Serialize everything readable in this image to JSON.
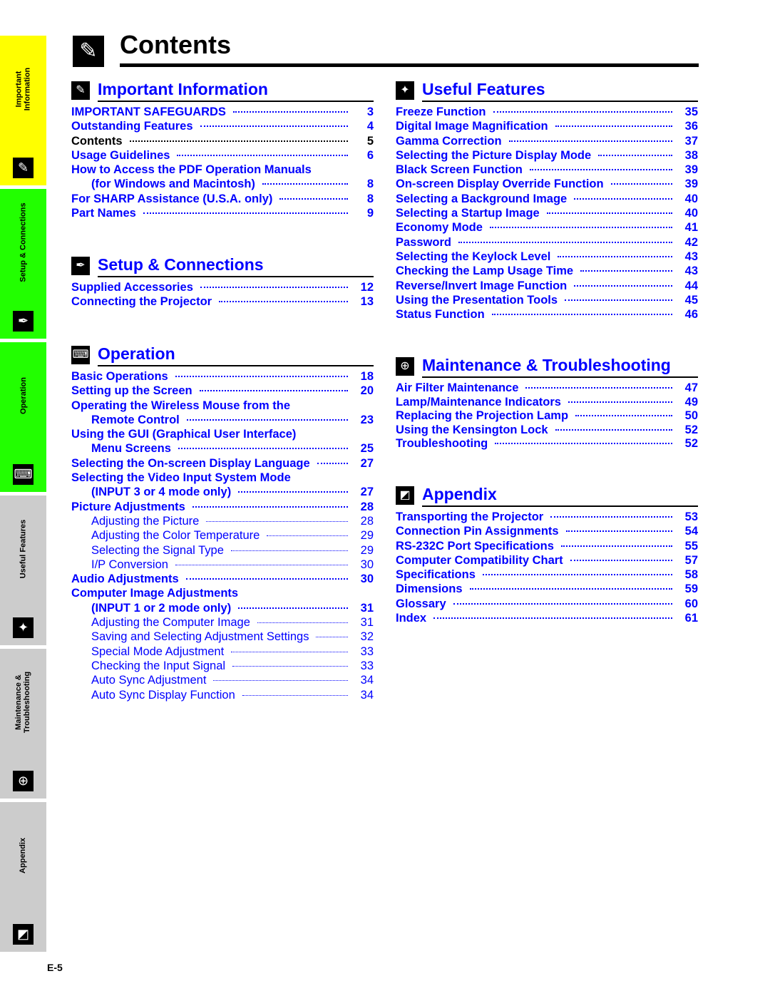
{
  "page_title": "Contents",
  "page_number": "E-5",
  "colors": {
    "link": "#0000ff",
    "tab_important": "#ffff00",
    "tab_setup": "#22ff00",
    "tab_operation": "#22ff00",
    "tab_inactive": "#cccccc"
  },
  "tabs": [
    {
      "label": "Important\nInformation",
      "icon": "paperclip-icon"
    },
    {
      "label": "Setup & Connections",
      "icon": "pen-icon"
    },
    {
      "label": "Operation",
      "icon": "remote-icon"
    },
    {
      "label": "Useful Features",
      "icon": "sparkle-icon"
    },
    {
      "label": "Maintenance &\nTroubleshooting",
      "icon": "lifebuoy-icon"
    },
    {
      "label": "Appendix",
      "icon": "document-icon"
    }
  ],
  "sections": [
    {
      "title": "Important Information",
      "icon": "paperclip-icon",
      "entries": [
        {
          "text": "IMPORTANT SAFEGUARDS",
          "page": "3"
        },
        {
          "text": "Outstanding Features",
          "page": "4"
        },
        {
          "text": "Contents",
          "page": "5",
          "style": "black"
        },
        {
          "text": "Usage Guidelines",
          "page": "6"
        },
        {
          "text": "How to Access the PDF Operation Manuals",
          "page": ""
        },
        {
          "text": "(for Windows and Macintosh)",
          "page": "8",
          "indent": true
        },
        {
          "text": "For SHARP Assistance (U.S.A. only)",
          "page": "8"
        },
        {
          "text": "Part Names",
          "page": "9"
        }
      ]
    },
    {
      "title": "Setup & Connections",
      "icon": "pen-icon",
      "entries": [
        {
          "text": "Supplied Accessories",
          "page": "12"
        },
        {
          "text": "Connecting the Projector",
          "page": "13"
        }
      ]
    },
    {
      "title": "Operation",
      "icon": "remote-icon",
      "entries": [
        {
          "text": "Basic Operations",
          "page": "18"
        },
        {
          "text": "Setting up the Screen",
          "page": "20"
        },
        {
          "text": "Operating the Wireless Mouse from the",
          "page": ""
        },
        {
          "text": "Remote Control",
          "page": "23",
          "indent": true
        },
        {
          "text": "Using the GUI (Graphical User Interface)",
          "page": ""
        },
        {
          "text": "Menu Screens",
          "page": "25",
          "indent": true
        },
        {
          "text": "Selecting the On-screen Display Language",
          "page": "27"
        },
        {
          "text": "Selecting the Video Input System Mode",
          "page": ""
        },
        {
          "text": "(INPUT 3 or 4 mode only)",
          "page": "27",
          "indent": true
        },
        {
          "text": "Picture Adjustments",
          "page": "28"
        },
        {
          "text": "Adjusting the Picture",
          "page": "28",
          "indent": true,
          "style": "sub"
        },
        {
          "text": "Adjusting the Color Temperature",
          "page": "29",
          "indent": true,
          "style": "sub"
        },
        {
          "text": "Selecting the Signal Type",
          "page": "29",
          "indent": true,
          "style": "sub"
        },
        {
          "text": "I/P Conversion",
          "page": "30",
          "indent": true,
          "style": "sub"
        },
        {
          "text": "Audio Adjustments",
          "page": "30"
        },
        {
          "text": "Computer Image Adjustments",
          "page": ""
        },
        {
          "text": "(INPUT 1 or 2 mode only)",
          "page": "31",
          "indent": true
        },
        {
          "text": "Adjusting the Computer Image",
          "page": "31",
          "indent": true,
          "style": "sub"
        },
        {
          "text": "Saving and Selecting Adjustment Settings",
          "page": "32",
          "indent": true,
          "style": "sub"
        },
        {
          "text": "Special Mode Adjustment",
          "page": "33",
          "indent": true,
          "style": "sub"
        },
        {
          "text": "Checking the Input Signal",
          "page": "33",
          "indent": true,
          "style": "sub"
        },
        {
          "text": "Auto Sync Adjustment",
          "page": "34",
          "indent": true,
          "style": "sub"
        },
        {
          "text": "Auto Sync Display Function",
          "page": "34",
          "indent": true,
          "style": "sub"
        }
      ]
    },
    {
      "title": "Useful Features",
      "icon": "sparkle-icon",
      "entries": [
        {
          "text": "Freeze Function",
          "page": "35"
        },
        {
          "text": "Digital Image Magnification",
          "page": "36"
        },
        {
          "text": "Gamma Correction",
          "page": "37"
        },
        {
          "text": "Selecting the Picture Display Mode",
          "page": "38"
        },
        {
          "text": "Black Screen Function",
          "page": "39"
        },
        {
          "text": "On-screen Display Override Function",
          "page": "39"
        },
        {
          "text": "Selecting a Background Image",
          "page": "40"
        },
        {
          "text": "Selecting a Startup Image",
          "page": "40"
        },
        {
          "text": "Economy Mode",
          "page": "41"
        },
        {
          "text": "Password",
          "page": "42"
        },
        {
          "text": "Selecting the Keylock Level",
          "page": "43"
        },
        {
          "text": "Checking the Lamp Usage Time",
          "page": "43"
        },
        {
          "text": "Reverse/Invert Image Function",
          "page": "44"
        },
        {
          "text": "Using the Presentation Tools",
          "page": "45"
        },
        {
          "text": "Status Function",
          "page": "46"
        }
      ]
    },
    {
      "title": "Maintenance & Troubleshooting",
      "icon": "lifebuoy-icon",
      "entries": [
        {
          "text": "Air Filter Maintenance",
          "page": "47"
        },
        {
          "text": "Lamp/Maintenance Indicators",
          "page": "49"
        },
        {
          "text": "Replacing the Projection Lamp",
          "page": "50"
        },
        {
          "text": "Using the Kensington Lock",
          "page": "52"
        },
        {
          "text": "Troubleshooting",
          "page": "52"
        }
      ]
    },
    {
      "title": "Appendix",
      "icon": "document-icon",
      "entries": [
        {
          "text": "Transporting the Projector",
          "page": "53"
        },
        {
          "text": "Connection Pin Assignments",
          "page": "54"
        },
        {
          "text": "RS-232C Port Specifications",
          "page": "55"
        },
        {
          "text": "Computer Compatibility Chart",
          "page": "57"
        },
        {
          "text": "Specifications",
          "page": "58"
        },
        {
          "text": "Dimensions",
          "page": "59"
        },
        {
          "text": "Glossary",
          "page": "60"
        },
        {
          "text": "Index",
          "page": "61"
        }
      ]
    }
  ]
}
